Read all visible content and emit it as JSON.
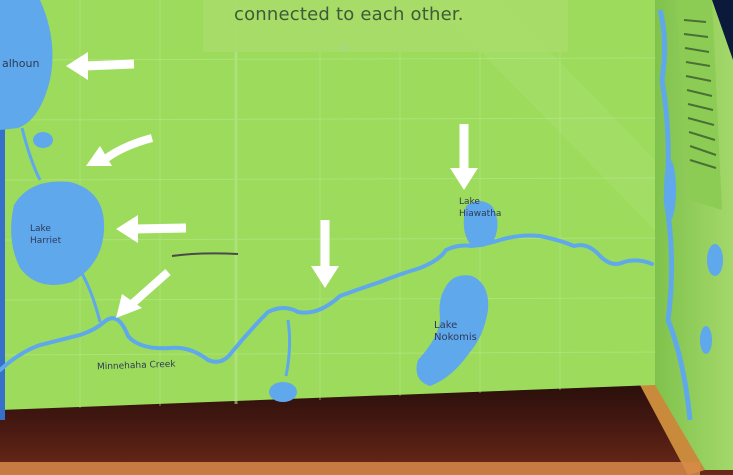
{
  "sign": {
    "caption": "connected to each other.",
    "lakes": {
      "calhoun": "alhoun",
      "harriet": [
        "Lake",
        "Harriet"
      ],
      "hiawatha": [
        "Lake",
        "Hiawatha"
      ],
      "nokomis": [
        "Lake",
        "Nokomis"
      ]
    },
    "creek": "Minnehaha Creek",
    "colors": {
      "land": "#9ddb5c",
      "water": "#5fa8ec",
      "arrow": "#ffffff",
      "base": "#3a1610",
      "background": "#0b1a3a"
    }
  }
}
